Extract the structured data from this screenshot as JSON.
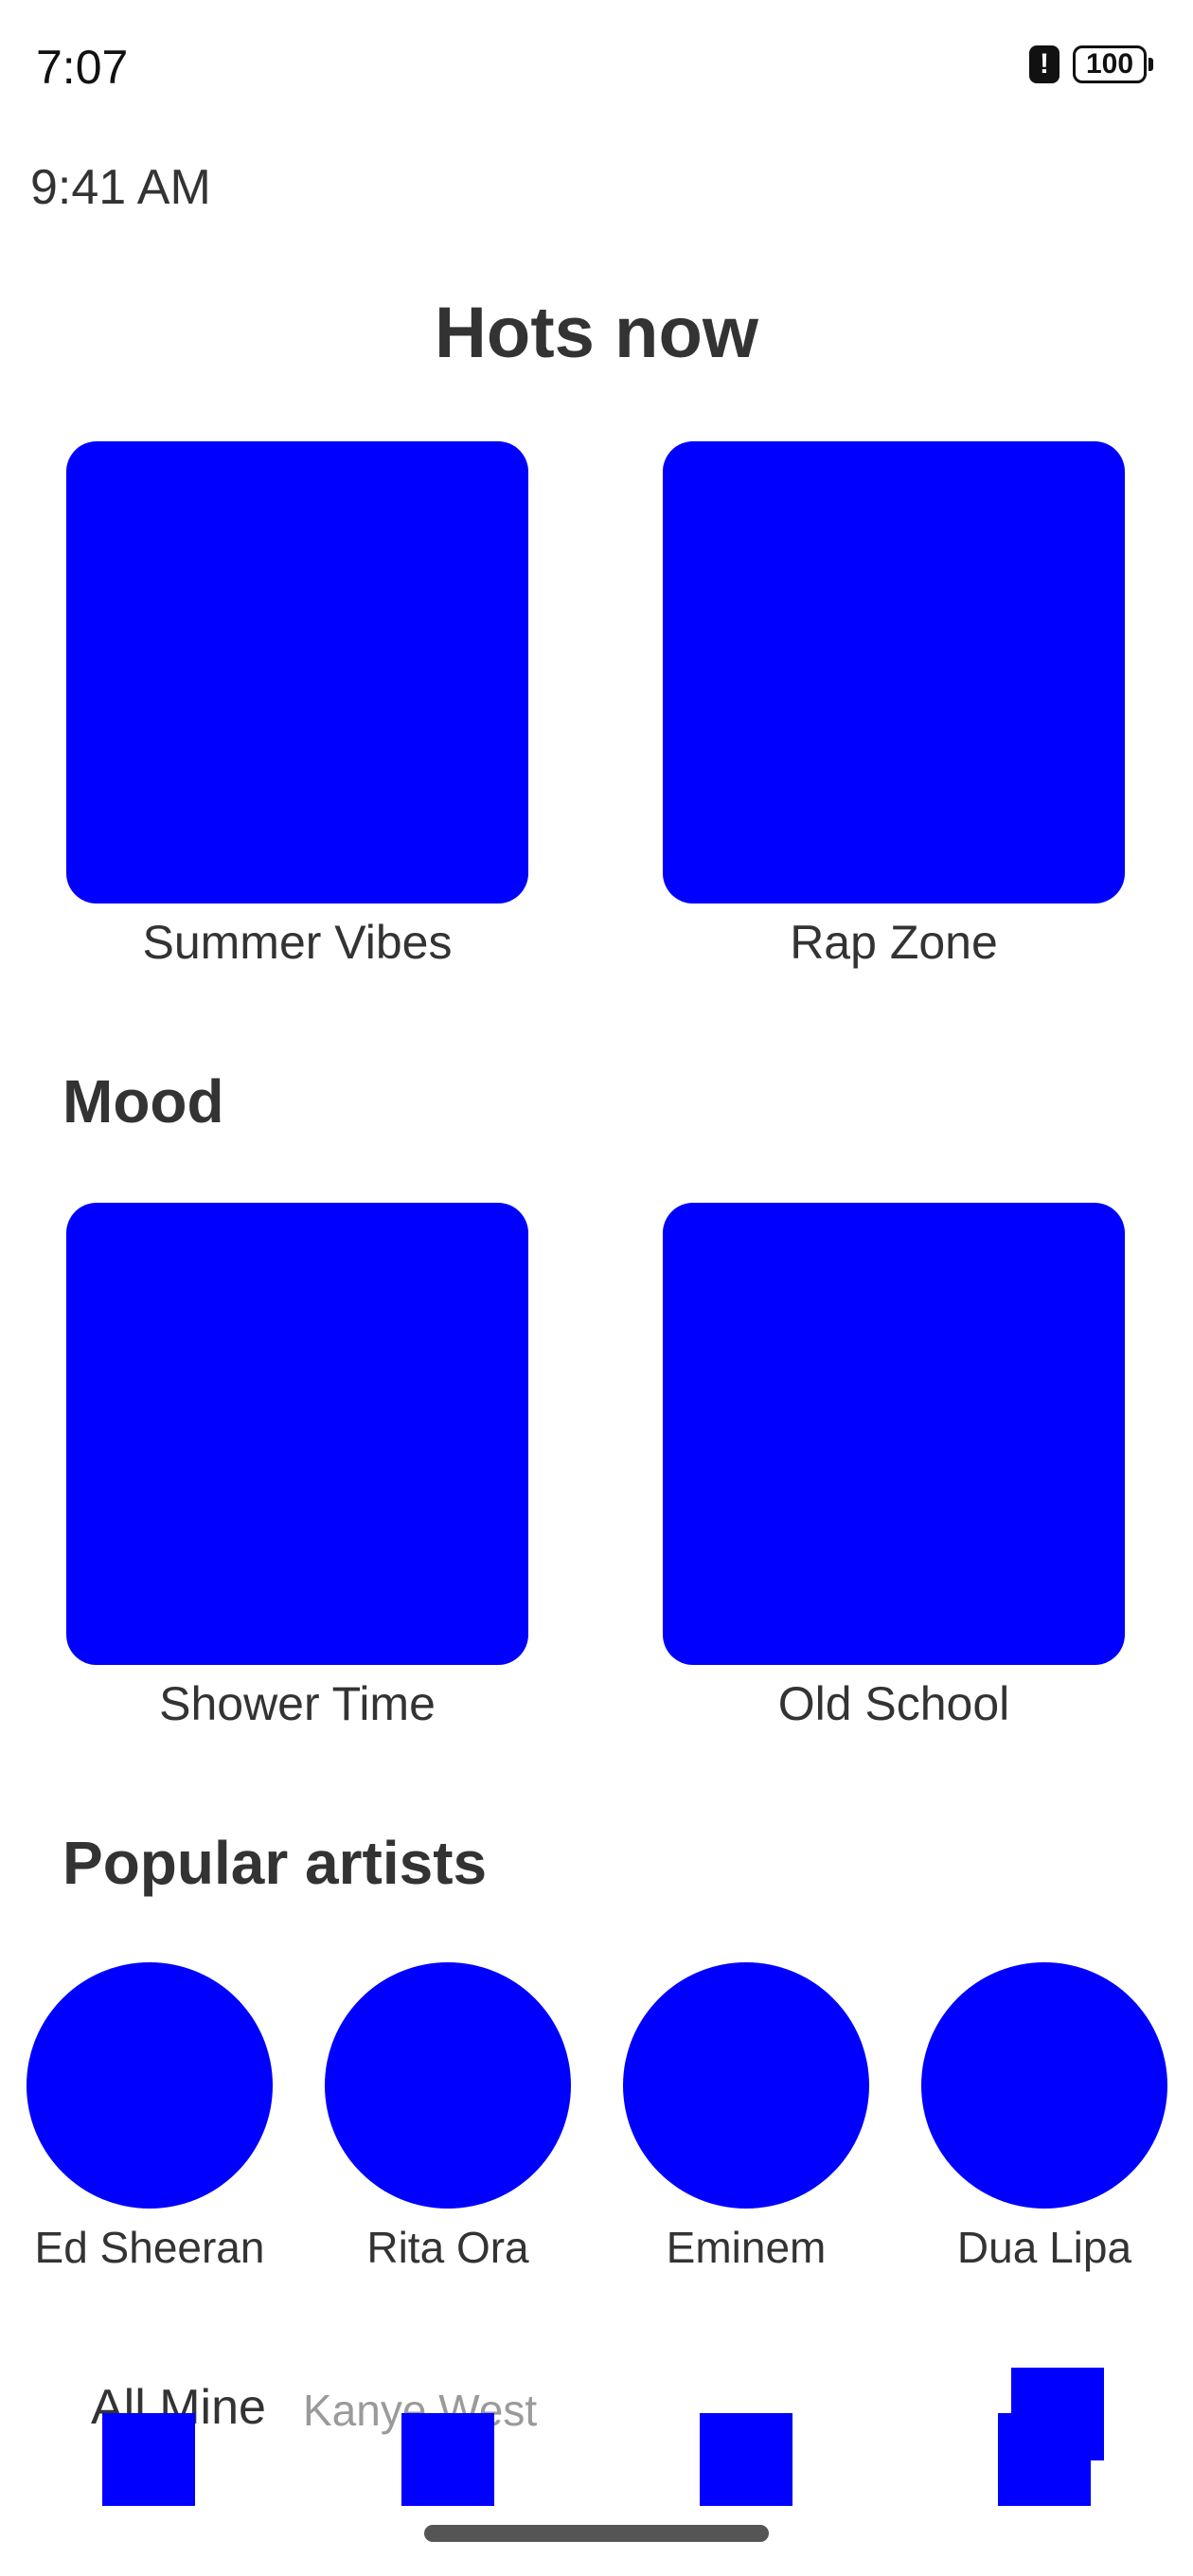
{
  "status_bar": {
    "time": "7:07",
    "alert_glyph": "!",
    "battery": "100"
  },
  "clock_label": "9:41 AM",
  "hots": {
    "title": "Hots now",
    "items": [
      {
        "label": "Summer Vibes"
      },
      {
        "label": "Rap Zone"
      }
    ]
  },
  "mood": {
    "title": "Mood",
    "items": [
      {
        "label": "Shower Time"
      },
      {
        "label": "Old School"
      }
    ]
  },
  "artists": {
    "title": "Popular artists",
    "items": [
      {
        "name": "Ed Sheeran"
      },
      {
        "name": "Rita Ora"
      },
      {
        "name": "Eminem"
      },
      {
        "name": "Dua Lipa"
      }
    ]
  },
  "bottom_bar": {
    "tab_label": "All Mine",
    "now_playing_artist": "Kanye West"
  },
  "colors": {
    "placeholder": "#0000ff",
    "text": "#333333",
    "muted": "#9a9a9a"
  }
}
